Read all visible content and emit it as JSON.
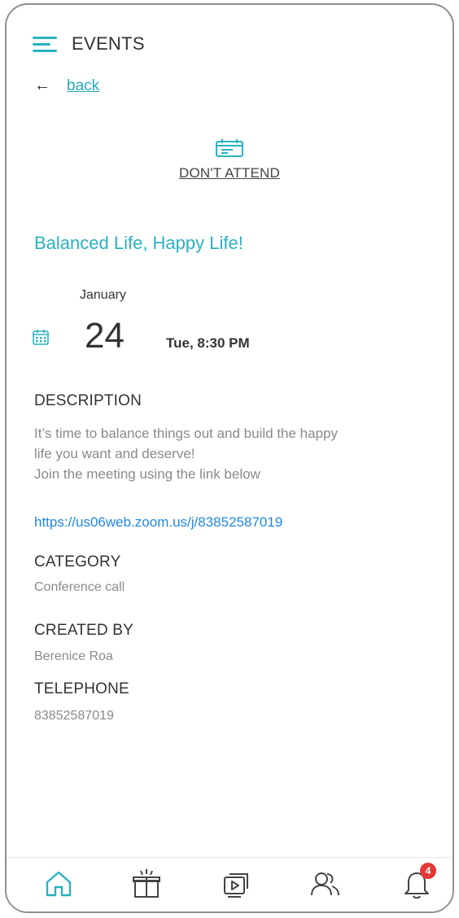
{
  "header": {
    "title": "EVENTS"
  },
  "back": {
    "label": "back"
  },
  "attend": {
    "label": "DON'T ATTEND"
  },
  "event": {
    "title": "Balanced Life, Happy Life!",
    "month": "January",
    "day": "24",
    "time": "Tue, 8:30 PM",
    "description_heading": "DESCRIPTION",
    "description_lines": [
      "It’s time to balance things out and build the happy",
      "life you want and deserve!",
      "Join the meeting using the link below"
    ],
    "link": "https://us06web.zoom.us/j/83852587019",
    "category_heading": "CATEGORY",
    "category": "Conference call",
    "created_by_heading": "CREATED BY",
    "created_by": "Berenice Roa",
    "telephone_heading": "TELEPHONE",
    "telephone": "83852587019"
  },
  "bottom_nav": {
    "items": [
      {
        "icon": "home-icon",
        "active": true
      },
      {
        "icon": "gift-icon",
        "active": false
      },
      {
        "icon": "media-icon",
        "active": false
      },
      {
        "icon": "users-icon",
        "active": false
      },
      {
        "icon": "bell-icon",
        "active": false
      }
    ],
    "notification_count": "4"
  },
  "colors": {
    "accent": "#29b3c1",
    "link": "#1e88e5",
    "badge": "#e53935"
  }
}
